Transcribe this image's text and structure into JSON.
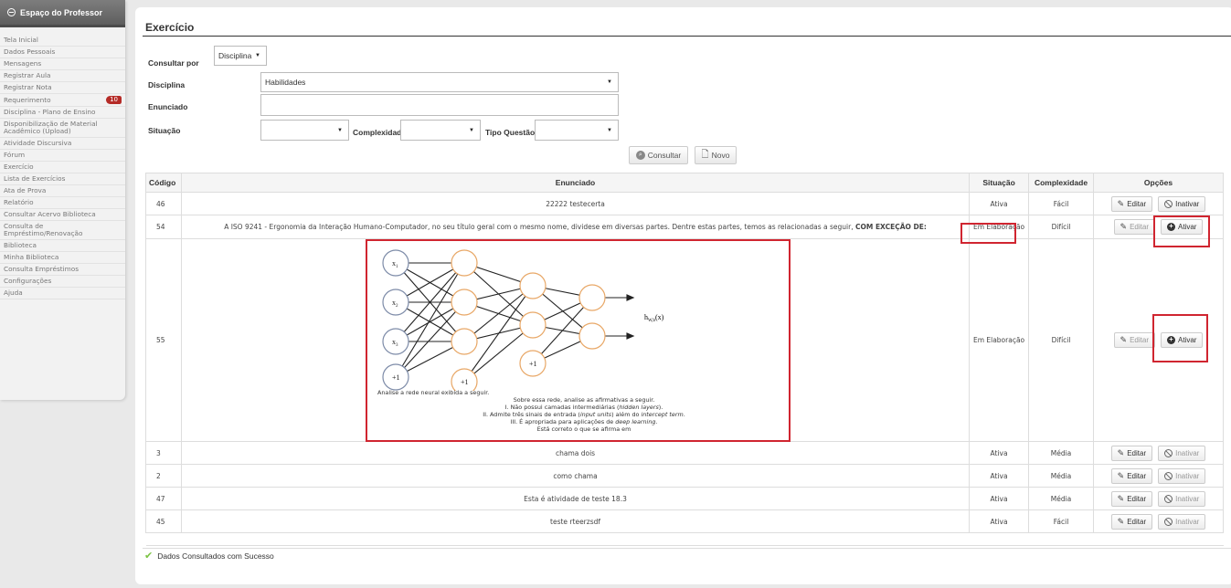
{
  "sidebar": {
    "title": "Espaço do Professor",
    "items": [
      {
        "label": "Tela Inicial"
      },
      {
        "label": "Dados Pessoais"
      },
      {
        "label": "Mensagens"
      },
      {
        "label": "Registrar Aula"
      },
      {
        "label": "Registrar Nota"
      },
      {
        "label": "Requerimento",
        "badge": "10"
      },
      {
        "label": "Disciplina - Plano de Ensino"
      },
      {
        "label": "Disponibilização de Material Acadêmico (Upload)"
      },
      {
        "label": "Atividade Discursiva"
      },
      {
        "label": "Fórum"
      },
      {
        "label": "Exercício"
      },
      {
        "label": "Lista de Exercícios"
      },
      {
        "label": "Ata de Prova"
      },
      {
        "label": "Relatório"
      },
      {
        "label": "Consultar Acervo Biblioteca"
      },
      {
        "label": "Consulta de Empréstimo/Renovação"
      },
      {
        "label": "Biblioteca"
      },
      {
        "label": "Minha Biblioteca"
      },
      {
        "label": "Consulta Empréstimos"
      },
      {
        "label": "Configurações"
      },
      {
        "label": "Ajuda"
      }
    ]
  },
  "page": {
    "title": "Exercício"
  },
  "filters": {
    "consultar_por_label": "Consultar por",
    "consultar_por_value": "Disciplina",
    "disciplina_label": "Disciplina",
    "disciplina_value": "Habilidades",
    "enunciado_label": "Enunciado",
    "enunciado_value": "",
    "situacao_label": "Situação",
    "situacao_value": "",
    "complexidade_label": "Complexidade",
    "complexidade_value": "",
    "tipo_label": "Tipo Questão",
    "tipo_value": ""
  },
  "actions": {
    "consultar": "Consultar",
    "novo": "Novo"
  },
  "table": {
    "headers": [
      "Código",
      "Enunciado",
      "Situação",
      "Complexidade",
      "Opções"
    ],
    "edit_label": "Editar",
    "inactivate_label": "Inativar",
    "activate_label": "Ativar",
    "rows": [
      {
        "code": "46",
        "text": "22222 testecerta",
        "status": "Ativa",
        "complexity": "Fácil"
      },
      {
        "code": "54",
        "text": "A ISO 9241 - Ergonomia da Interação Humano-Computador, no seu título geral com o mesmo nome, dividese em diversas partes. Dentre estas partes, temos as relacionadas a seguir,",
        "text_bold": "COM EXCEÇÃO DE:",
        "status": "Em Elaboração",
        "complexity": "Difícil"
      },
      {
        "code": "55",
        "status": "Em Elaboração",
        "complexity": "Difícil"
      },
      {
        "code": "3",
        "text": "chama dois",
        "status": "Ativa",
        "complexity": "Média"
      },
      {
        "code": "2",
        "text": "como chama",
        "status": "Ativa",
        "complexity": "Média"
      },
      {
        "code": "47",
        "text": "Esta é atividade de teste 18.3",
        "status": "Ativa",
        "complexity": "Média"
      },
      {
        "code": "45",
        "text": "teste rteerzsdf",
        "status": "Ativa",
        "complexity": "Fácil"
      }
    ]
  },
  "question55": {
    "intro": "Analise a rede neural exibida a seguir.",
    "line1": "Sobre essa rede, analise as afirmativas a seguir.",
    "line2a": "I. Não possui camadas intermediárias (",
    "line2i": "hidden layers",
    "line2b": ").",
    "line3a": "II. Admite três sinais de entrada (",
    "line3i": "input units",
    "line3b": ") além do ",
    "line3i2": "intercept term",
    "line3c": ".",
    "line4a": "III. É apropriada para aplicações de ",
    "line4i": "deep learning",
    "line4b": ".",
    "line5": "Está correto o que se afirma em",
    "nn": {
      "x1": "x",
      "x2": "x",
      "x3": "x",
      "sub1": "1",
      "sub2": "2",
      "sub3": "3",
      "bias": "+1",
      "output": "h",
      "output_sub": "W,b",
      "output_arg": "(x)"
    }
  },
  "status": {
    "message": "Dados Consultados com Sucesso"
  },
  "colors": {
    "highlight": "#d02530",
    "badge": "#b52b27",
    "success": "#7bc443"
  }
}
